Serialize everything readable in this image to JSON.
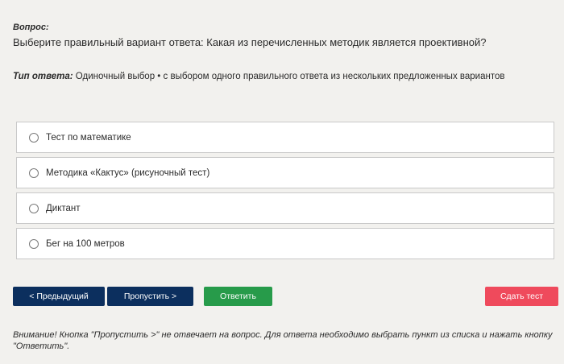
{
  "question": {
    "label": "Вопрос:",
    "text": "Выберите правильный вариант ответа: Какая из перечисленных методик является проективной?"
  },
  "answer_type": {
    "label": "Тип ответа:",
    "value": "Одиночный выбор • с выбором одного правильного ответа из нескольких предложенных вариантов"
  },
  "options": [
    {
      "label": "Тест по математике",
      "selected": false
    },
    {
      "label": "Методика «Кактус» (рисуночный тест)",
      "selected": false
    },
    {
      "label": "Диктант",
      "selected": false
    },
    {
      "label": "Бег на 100 метров",
      "selected": false
    }
  ],
  "buttons": {
    "prev": "< Предыдущий",
    "skip": "Пропустить >",
    "answer": "Ответить",
    "submit": "Сдать тест"
  },
  "colors": {
    "navy": "#0c2f5e",
    "green": "#279b4a",
    "red": "#ef4a5c",
    "background": "#f2f1ee"
  },
  "notice": "Внимание! Кнопка \"Пропустить >\" не отвечает на вопрос. Для ответа необходимо выбрать пункт из списка и нажать кнопку \"Ответить\"."
}
